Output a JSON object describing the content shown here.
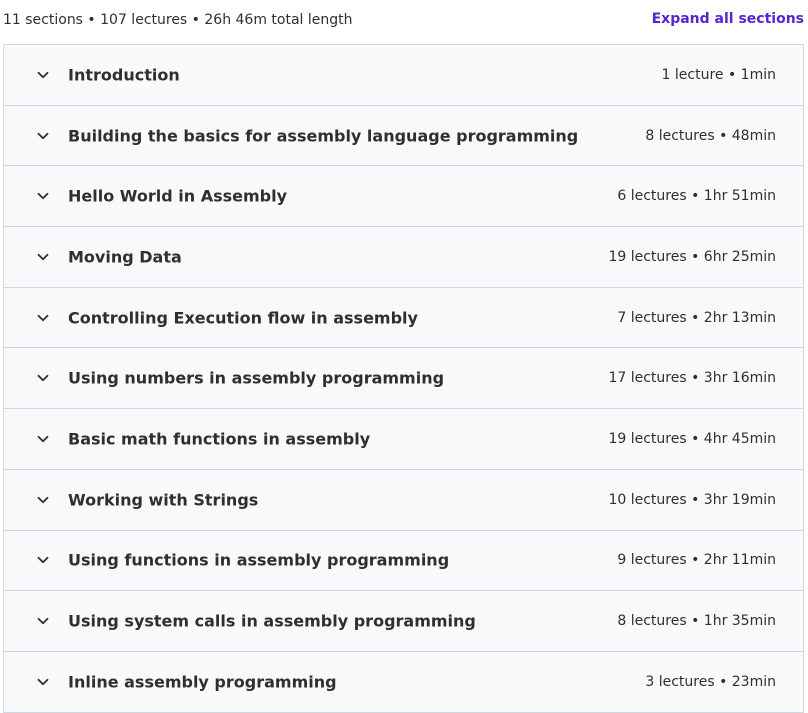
{
  "summary": {
    "text": "11 sections • 107 lectures • 26h 46m total length",
    "expand_label": "Expand all sections"
  },
  "colors": {
    "accent": "#5624d0",
    "row_background": "#f7f9fa",
    "border": "#d1d7dc",
    "text": "#2d2f31"
  },
  "sections": [
    {
      "title": "Introduction",
      "meta": "1 lecture • 1min",
      "icon": "chevron-down-icon"
    },
    {
      "title": "Building the basics for assembly language programming",
      "meta": "8 lectures • 48min",
      "icon": "chevron-down-icon"
    },
    {
      "title": "Hello World in Assembly",
      "meta": "6 lectures • 1hr 51min",
      "icon": "chevron-down-icon"
    },
    {
      "title": "Moving Data",
      "meta": "19 lectures • 6hr 25min",
      "icon": "chevron-down-icon"
    },
    {
      "title": "Controlling Execution flow in assembly",
      "meta": "7 lectures • 2hr 13min",
      "icon": "chevron-down-icon"
    },
    {
      "title": "Using numbers in assembly programming",
      "meta": "17 lectures • 3hr 16min",
      "icon": "chevron-down-icon"
    },
    {
      "title": "Basic math functions in assembly",
      "meta": "19 lectures • 4hr 45min",
      "icon": "chevron-down-icon"
    },
    {
      "title": "Working with Strings",
      "meta": "10 lectures • 3hr 19min",
      "icon": "chevron-down-icon"
    },
    {
      "title": "Using functions in assembly programming",
      "meta": "9 lectures • 2hr 11min",
      "icon": "chevron-down-icon"
    },
    {
      "title": "Using system calls in assembly programming",
      "meta": "8 lectures • 1hr 35min",
      "icon": "chevron-down-icon"
    },
    {
      "title": "Inline assembly programming",
      "meta": "3 lectures • 23min",
      "icon": "chevron-down-icon"
    }
  ]
}
